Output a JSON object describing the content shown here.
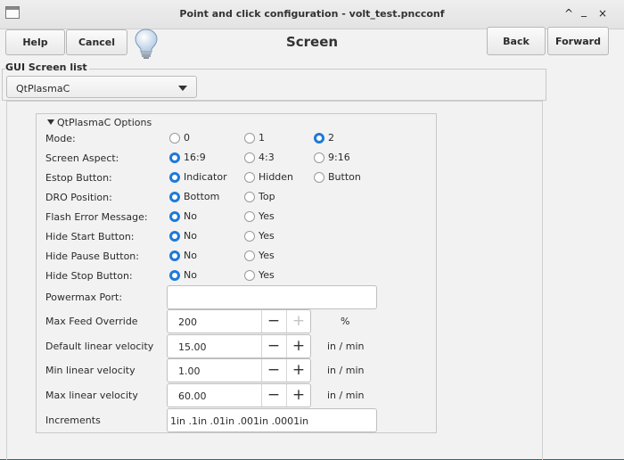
{
  "window": {
    "title": "Point and click configuration - volt_test.pncconf",
    "controls": [
      "^",
      "_",
      "×"
    ]
  },
  "toolbar": {
    "help": "Help",
    "cancel": "Cancel",
    "screen_title": "Screen",
    "back": "Back",
    "forward": "Forward"
  },
  "gui_list": {
    "label": "GUI Screen list",
    "selected": "QtPlasmaC"
  },
  "options": {
    "header": "QtPlasmaC Options",
    "radios": [
      {
        "label": "Mode:",
        "options": [
          "0",
          "1",
          "2"
        ],
        "selected": 2
      },
      {
        "label": "Screen Aspect:",
        "options": [
          "16:9",
          "4:3",
          "9:16"
        ],
        "selected": 0
      },
      {
        "label": "Estop Button:",
        "options": [
          "Indicator",
          "Hidden",
          "Button"
        ],
        "selected": 0
      },
      {
        "label": "DRO Position:",
        "options": [
          "Bottom",
          "Top"
        ],
        "selected": 0
      },
      {
        "label": "Flash Error Message:",
        "options": [
          "No",
          "Yes"
        ],
        "selected": 0
      },
      {
        "label": "Hide Start Button:",
        "options": [
          "No",
          "Yes"
        ],
        "selected": 0
      },
      {
        "label": "Hide Pause Button:",
        "options": [
          "No",
          "Yes"
        ],
        "selected": 0
      },
      {
        "label": "Hide Stop Button:",
        "options": [
          "No",
          "Yes"
        ],
        "selected": 0
      }
    ],
    "powermax": {
      "label": "Powermax Port:",
      "value": ""
    },
    "spins": [
      {
        "label": "Max Feed Override",
        "value": "200",
        "unit": "%",
        "plus_disabled": true
      },
      {
        "label": "Default linear velocity",
        "value": "15.00",
        "unit": "in / min",
        "plus_disabled": false
      },
      {
        "label": "Min linear velocity",
        "value": "1.00",
        "unit": "in / min",
        "plus_disabled": false
      },
      {
        "label": "Max linear velocity",
        "value": "60.00",
        "unit": "in / min",
        "plus_disabled": false
      }
    ],
    "spin_minus": "−",
    "spin_plus": "+",
    "increments": {
      "label": "Increments",
      "value": "1in .1in .01in .001in .0001in"
    }
  },
  "colors": {
    "accent": "#1f7ad8",
    "window_bg": "#f2f2f2",
    "desktop": "#1f6f6d"
  }
}
